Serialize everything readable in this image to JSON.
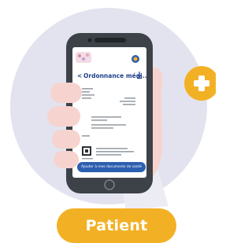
{
  "screen": {
    "title": "Ordonnance médi...",
    "back_symbol": "<",
    "add_button_label": "Ajouter à mes documents de santé"
  },
  "badge": {
    "label": "Patient"
  },
  "icons": {
    "plus": "plus-icon",
    "download": "download-icon",
    "qr": "qr-code-icon",
    "logo": "doctor-logo-icon"
  },
  "colors": {
    "circle_background": "#e3e3ef",
    "phone_body": "#3c4247",
    "hand_skin": "#f7d3cf",
    "sleeve": "#e9e8f2",
    "plus_circle": "#f2b125",
    "pill": "#f2b125",
    "title_blue": "#1f3f8c",
    "button_blue": "#2d5fb0"
  }
}
